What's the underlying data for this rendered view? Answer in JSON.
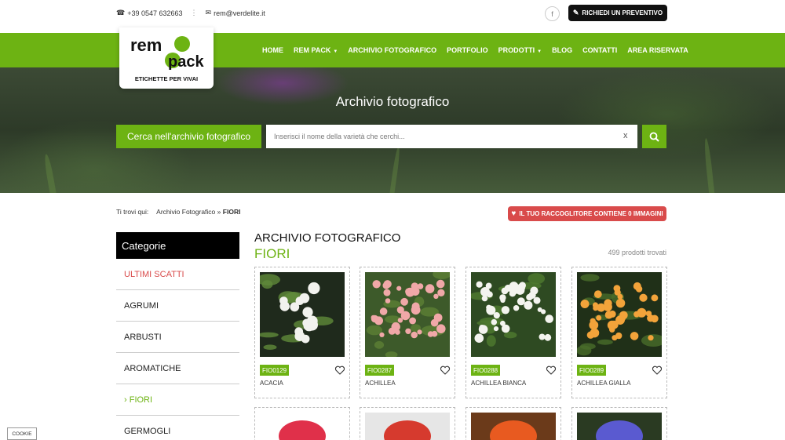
{
  "topbar": {
    "phone": "+39 0547 632663",
    "email": "rem@verdelite.it",
    "facebook_label": "f",
    "quote_button": "RICHIEDI UN PREVENTIVO"
  },
  "logo": {
    "tagline": "ETICHETTE PER VIVAI"
  },
  "nav": {
    "items": [
      {
        "label": "HOME",
        "has_caret": false
      },
      {
        "label": "REM PACK",
        "has_caret": true
      },
      {
        "label": "ARCHIVIO FOTOGRAFICO",
        "has_caret": false
      },
      {
        "label": "PORTFOLIO",
        "has_caret": false
      },
      {
        "label": "PRODOTTI",
        "has_caret": true
      },
      {
        "label": "BLOG",
        "has_caret": false
      },
      {
        "label": "CONTATTI",
        "has_caret": false
      },
      {
        "label": "AREA RISERVATA",
        "has_caret": false
      }
    ]
  },
  "hero": {
    "title": "Archivio fotografico",
    "search_label": "Cerca nell'archivio fotografico",
    "search_placeholder": "Inserisci il nome della varietà che cerchi...",
    "clear_label": "x"
  },
  "breadcrumb": {
    "label": "Ti trovi qui:",
    "parent": "Archivio Fotografico",
    "separator": "»",
    "current": "FIORI"
  },
  "collector": {
    "text": "IL TUO RACCOGLITORE  CONTIENE 0 IMMAGINI"
  },
  "sidebar": {
    "heading": "Categorie",
    "items": [
      {
        "label": "ULTIMI SCATTI",
        "state": "highlight"
      },
      {
        "label": "AGRUMI",
        "state": "normal"
      },
      {
        "label": "ARBUSTI",
        "state": "normal"
      },
      {
        "label": "AROMATICHE",
        "state": "normal"
      },
      {
        "label": "› FIORI",
        "state": "active"
      },
      {
        "label": "GERMOGLI",
        "state": "normal"
      }
    ]
  },
  "main": {
    "title": "ARCHIVIO FOTOGRAFICO",
    "subtitle": "FIORI",
    "count": "499 prodotti trovati",
    "products": [
      {
        "code": "FIO0129",
        "name": "ACACIA",
        "bg": "#1f2a1c",
        "flower": "#f2f2ee",
        "leaf": "#5f8a3a"
      },
      {
        "code": "FIO0287",
        "name": "ACHILLEA",
        "bg": "#3d5a2a",
        "flower": "#f0a8a8",
        "leaf": "#5d7f35"
      },
      {
        "code": "FIO0288",
        "name": "ACHILLEA BIANCA",
        "bg": "#2e4a22",
        "flower": "#f4f4ef",
        "leaf": "#4f7a30"
      },
      {
        "code": "FIO0289",
        "name": "ACHILLEA GIALLA",
        "bg": "#203018",
        "flower": "#f2a33a",
        "leaf": "#496d2a"
      }
    ],
    "row2": [
      {
        "bg": "#ffffff",
        "accent": "#e0304a"
      },
      {
        "bg": "#e6e6e6",
        "accent": "#d63a2e"
      },
      {
        "bg": "#6b3a1a",
        "accent": "#e85a20"
      },
      {
        "bg": "#2a3a22",
        "accent": "#5a5ad0"
      }
    ]
  },
  "cookie": {
    "label": "COOKIE"
  },
  "colors": {
    "brand_green": "#6db313",
    "accent_red": "#d94b4b",
    "dark": "#111111"
  }
}
